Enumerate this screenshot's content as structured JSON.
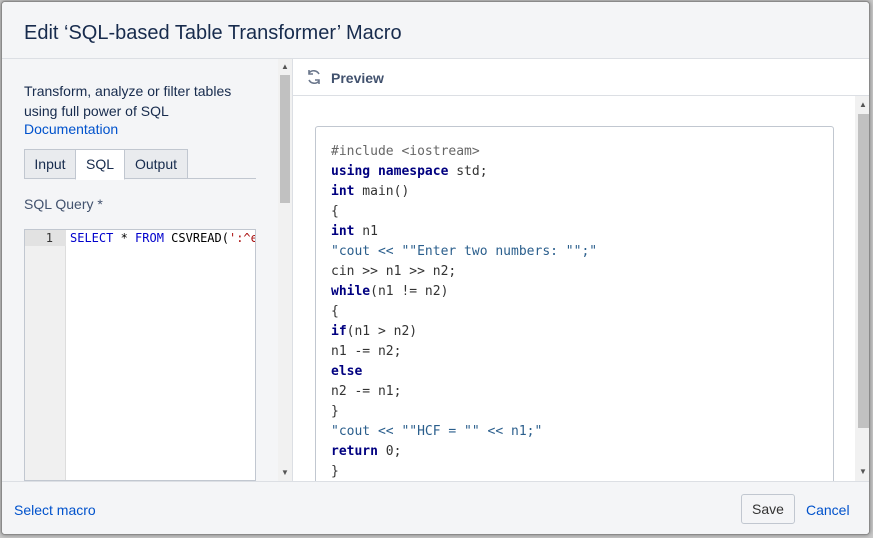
{
  "dialog": {
    "title": "Edit ‘SQL-based Table Transformer’ Macro"
  },
  "left_panel": {
    "description": "Transform, analyze or filter tables using full power of SQL",
    "doc_link": "Documentation",
    "tabs": [
      {
        "label": "Input",
        "active": false
      },
      {
        "label": "SQL",
        "active": true
      },
      {
        "label": "Output",
        "active": false
      }
    ],
    "query_label": "SQL Query *",
    "editor": {
      "line_number": "1",
      "kw1": "SELECT",
      "op": " * ",
      "kw2": "FROM",
      "fn": " CSVREAD(",
      "str": "':^e"
    }
  },
  "preview": {
    "label": "Preview",
    "code_lines": [
      {
        "text": "#include <iostream>",
        "type": "pre"
      },
      {
        "text": "using namespace std;",
        "type": "mixed"
      },
      {
        "text": "int main()",
        "type": "mixed"
      },
      {
        "text": "{",
        "type": "plain"
      },
      {
        "text": "int n1",
        "type": "mixed"
      },
      {
        "text": "\"cout << \"\"Enter two numbers: \"\";\"",
        "type": "str"
      },
      {
        "text": "cin >> n1 >> n2;",
        "type": "plain"
      },
      {
        "text": "while(n1 != n2)",
        "type": "mixed"
      },
      {
        "text": "{",
        "type": "plain"
      },
      {
        "text": "if(n1 > n2)",
        "type": "mixed"
      },
      {
        "text": "n1 -= n2;",
        "type": "plain"
      },
      {
        "text": "else",
        "type": "kw"
      },
      {
        "text": "n2 -= n1;",
        "type": "plain"
      },
      {
        "text": "}",
        "type": "plain"
      },
      {
        "text": "\"cout << \"\"HCF = \"\" << n1;\"",
        "type": "str"
      },
      {
        "text": "return 0;",
        "type": "mixed"
      },
      {
        "text": "}",
        "type": "plain"
      }
    ]
  },
  "footer": {
    "select_macro": "Select macro",
    "save": "Save",
    "cancel": "Cancel"
  },
  "colors": {
    "link": "#0052cc",
    "keyword": "#000080",
    "header_bg": "#f4f5f7"
  }
}
